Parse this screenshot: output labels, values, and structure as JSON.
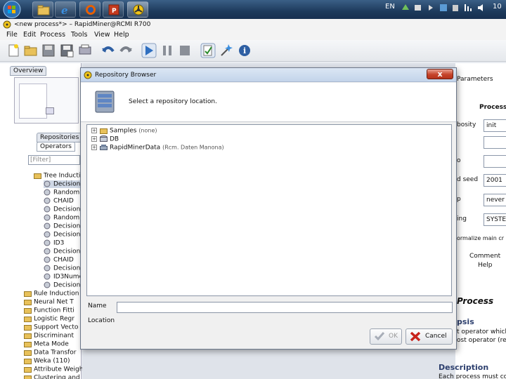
{
  "taskbar": {
    "tray_lang": "EN",
    "tray_time": "10"
  },
  "app": {
    "title": "<new process*> – RapidMiner@RCMI R700"
  },
  "menu": [
    "File",
    "Edit",
    "Process",
    "Tools",
    "View",
    "Help"
  ],
  "left": {
    "overview_tab": "Overview",
    "repositories_tab": "Repositories",
    "operators_tab": "Operators",
    "filter_placeholder": "[Filter]",
    "tree": [
      "Tree Induction",
      "Decision",
      "Random",
      "CHAID",
      "Decision",
      "Random",
      "Decision",
      "Decision",
      "ID3",
      "Decision",
      "CHAID",
      "Decision",
      "ID3Nume",
      "Decision",
      "Rule Induction",
      "Neural Net T",
      "Function Fitti",
      "Logistic Regr",
      "Support Vecto",
      "Discriminant",
      "Meta Mode",
      "Data Transfor",
      "Weka (110)",
      "Attribute Weighting (30)",
      "Clustering and Segmentat"
    ]
  },
  "right": {
    "parameters_tab": "Parameters",
    "process_label": "Process",
    "fields": [
      {
        "label": "bosity",
        "value": "init"
      },
      {
        "label": "",
        "value": ""
      },
      {
        "label": "o",
        "value": ""
      },
      {
        "label": "d seed",
        "value": "2001"
      },
      {
        "label": "p",
        "value": "never"
      },
      {
        "label": "ing",
        "value": "SYSTEM"
      }
    ],
    "normalize": "ormalize main cr",
    "comment_tab": "Comment",
    "help_tab": "Help",
    "help_title": "Process",
    "synopsis": "psis",
    "synopsis_text": [
      "t operator which",
      "ost operator (re"
    ],
    "description": "Description",
    "description_text": "Each process must co"
  },
  "dialog": {
    "title": "Repository Browser",
    "close_label": "x",
    "header_text": "Select a repository location.",
    "repos": [
      {
        "name": "Samples",
        "sub": "(none)"
      },
      {
        "name": "DB",
        "sub": ""
      },
      {
        "name": "RapidMinerData",
        "sub": "(Rcm. Daten Manona)"
      }
    ],
    "name_label": "Name",
    "location_label": "Location",
    "name_value": "",
    "ok_label": "OK",
    "cancel_label": "Cancel"
  }
}
